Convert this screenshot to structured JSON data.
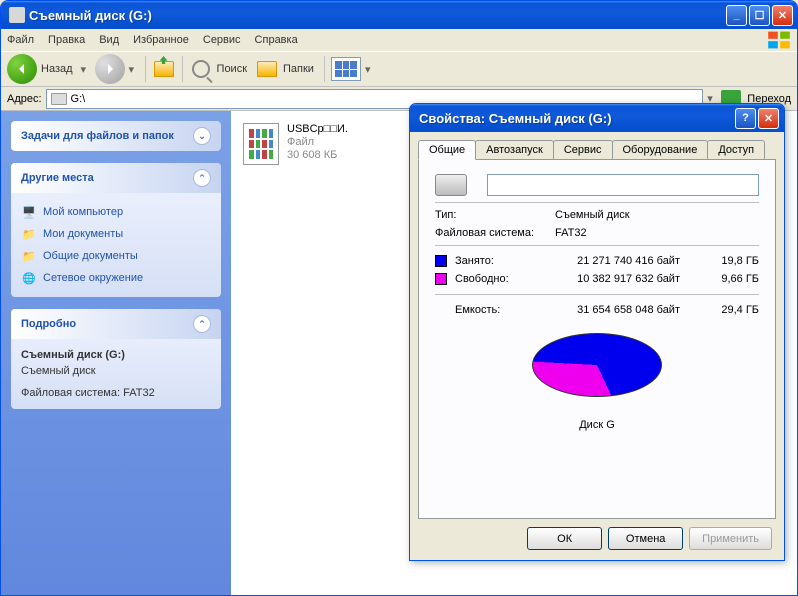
{
  "window": {
    "title": "Съемный диск (G:)",
    "menu": [
      "Файл",
      "Правка",
      "Вид",
      "Избранное",
      "Сервис",
      "Справка"
    ],
    "toolbar": {
      "back": "Назад",
      "search": "Поиск",
      "folders": "Папки"
    },
    "address_label": "Адрес:",
    "address_value": "G:\\",
    "go_label": "Переход"
  },
  "sidebar": {
    "tasks_header": "Задачи для файлов и папок",
    "places_header": "Другие места",
    "places": [
      {
        "label": "Мой компьютер"
      },
      {
        "label": "Мои документы"
      },
      {
        "label": "Общие документы"
      },
      {
        "label": "Сетевое окружение"
      }
    ],
    "details_header": "Подробно",
    "details": {
      "name": "Съемный диск (G:)",
      "type": "Съемный диск",
      "fs": "Файловая система: FAT32"
    }
  },
  "file": {
    "name": "USBCp□□И.",
    "type": "Файл",
    "size": "30 608 КБ"
  },
  "dialog": {
    "title": "Свойства: Съемный диск (G:)",
    "tabs": [
      "Общие",
      "Автозапуск",
      "Сервис",
      "Оборудование",
      "Доступ"
    ],
    "name_value": "",
    "type_label": "Тип:",
    "type_value": "Съемный диск",
    "fs_label": "Файловая система:",
    "fs_value": "FAT32",
    "used_label": "Занято:",
    "used_bytes": "21 271 740 416 байт",
    "used_gb": "19,8 ГБ",
    "free_label": "Свободно:",
    "free_bytes": "10 382 917 632 байт",
    "free_gb": "9,66 ГБ",
    "cap_label": "Емкость:",
    "cap_bytes": "31 654 658 048 байт",
    "cap_gb": "29,4 ГБ",
    "pie_label": "Диск G",
    "ok": "ОК",
    "cancel": "Отмена",
    "apply": "Применить"
  },
  "chart_data": {
    "type": "pie",
    "title": "Диск G",
    "categories": [
      "Занято",
      "Свободно"
    ],
    "values": [
      21271740416,
      10382917632
    ],
    "series": [
      {
        "name": "Занято",
        "value": 21271740416,
        "color": "#0000ee"
      },
      {
        "name": "Свободно",
        "value": 10382917632,
        "color": "#ee00ee"
      }
    ],
    "total": 31654658048
  }
}
